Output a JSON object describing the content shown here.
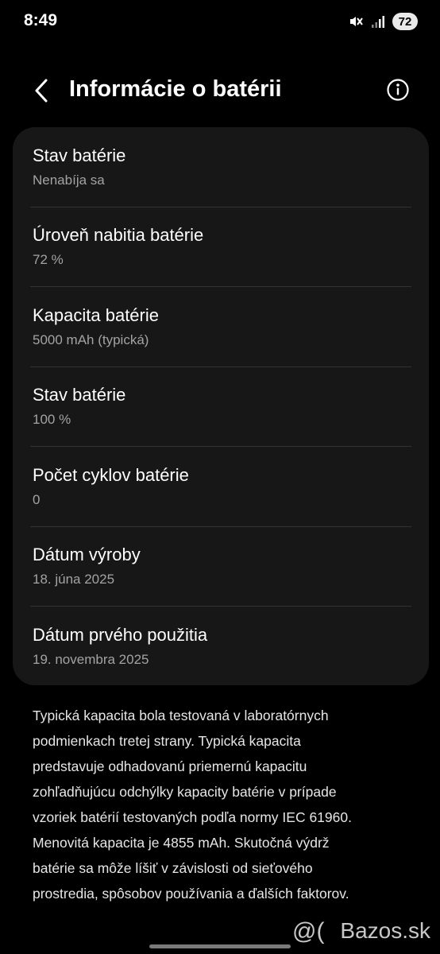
{
  "status_bar": {
    "time": "8:49",
    "battery_level": "72",
    "icons": [
      "mute-icon",
      "signal-icon",
      "battery-icon"
    ]
  },
  "header": {
    "title": "Informácie o batérii",
    "back_icon": "chevron-left-icon",
    "info_icon": "info-icon"
  },
  "items": [
    {
      "label": "Stav batérie",
      "value": "Nenabíja sa"
    },
    {
      "label": "Úroveň nabitia batérie",
      "value": "72 %"
    },
    {
      "label": "Kapacita batérie",
      "value": "5000 mAh (typická)"
    },
    {
      "label": "Stav batérie",
      "value": "100 %"
    },
    {
      "label": "Počet cyklov batérie",
      "value": "0"
    },
    {
      "label": "Dátum výroby",
      "value": "18. júna 2025"
    },
    {
      "label": "Dátum prvého použitia",
      "value": "19. novembra 2025"
    }
  ],
  "footnote_lines": [
    "Typická kapacita bola testovaná v laboratórnych",
    "podmienkach tretej strany. Typická kapacita",
    "predstavuje odhadovanú priemernú kapacitu",
    "zohľadňujúcu odchýlky kapacity batérie v prípade",
    "vzoriek batérií testovaných podľa normy IEC 61960.",
    "Menovitá kapacita je 4855 mAh. Skutočná výdrž",
    "batérie sa môže líšiť v závislosti od sieťového",
    "prostredia, spôsobov používania a ďalších faktorov."
  ],
  "watermark": {
    "text": "Bazos.sk"
  },
  "colors": {
    "background": "#000000",
    "card": "#171717",
    "primary_text": "#ffffff",
    "secondary_text": "#a3a3a3",
    "divider": "#333333"
  }
}
